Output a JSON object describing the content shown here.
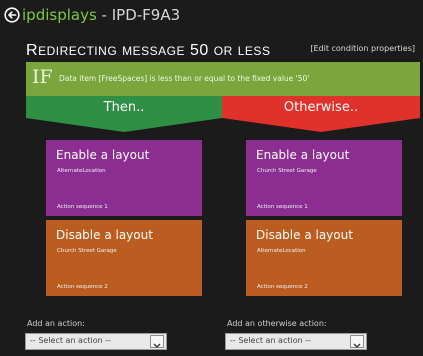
{
  "header": {
    "app_name": "ipdisplays",
    "separator": " - ",
    "device_name": "IPD-F9A3"
  },
  "rule": {
    "title": "Redirecting message 50 or less",
    "edit_link": "[Edit condition properties]"
  },
  "condition": {
    "keyword": "IF",
    "text": "Data item [FreeSpaces] is less than or equal to the fixed value '50'"
  },
  "branches": {
    "then_label": "Then..",
    "otherwise_label": "Otherwise.."
  },
  "then_actions": [
    {
      "title": "Enable a layout",
      "target": "AlternateLocation",
      "sequence": "Action sequence 1"
    },
    {
      "title": "Disable a layout",
      "target": "Church Street Garage",
      "sequence": "Action sequence 2"
    }
  ],
  "otherwise_actions": [
    {
      "title": "Enable a layout",
      "target": "Church Street Garage",
      "sequence": "Action sequence 1"
    },
    {
      "title": "Disable a layout",
      "target": "AlternateLocation",
      "sequence": "Action sequence 2"
    }
  ],
  "add_action": {
    "then_label": "Add an action:",
    "then_select_value": "-- Select an action --",
    "otherwise_label": "Add an otherwise action:",
    "otherwise_select_value": "-- Select an action --"
  },
  "colors": {
    "if_bar": "#7aa63d",
    "then_bar": "#2f8f45",
    "otherwise_bar": "#e0312a",
    "enable_card": "#8c2d92",
    "disable_card": "#bb5c20",
    "brand_green": "#7dc93e"
  },
  "icons": {
    "back": "circle-arrow-left-icon",
    "dropdown": "chevron-down-icon"
  }
}
